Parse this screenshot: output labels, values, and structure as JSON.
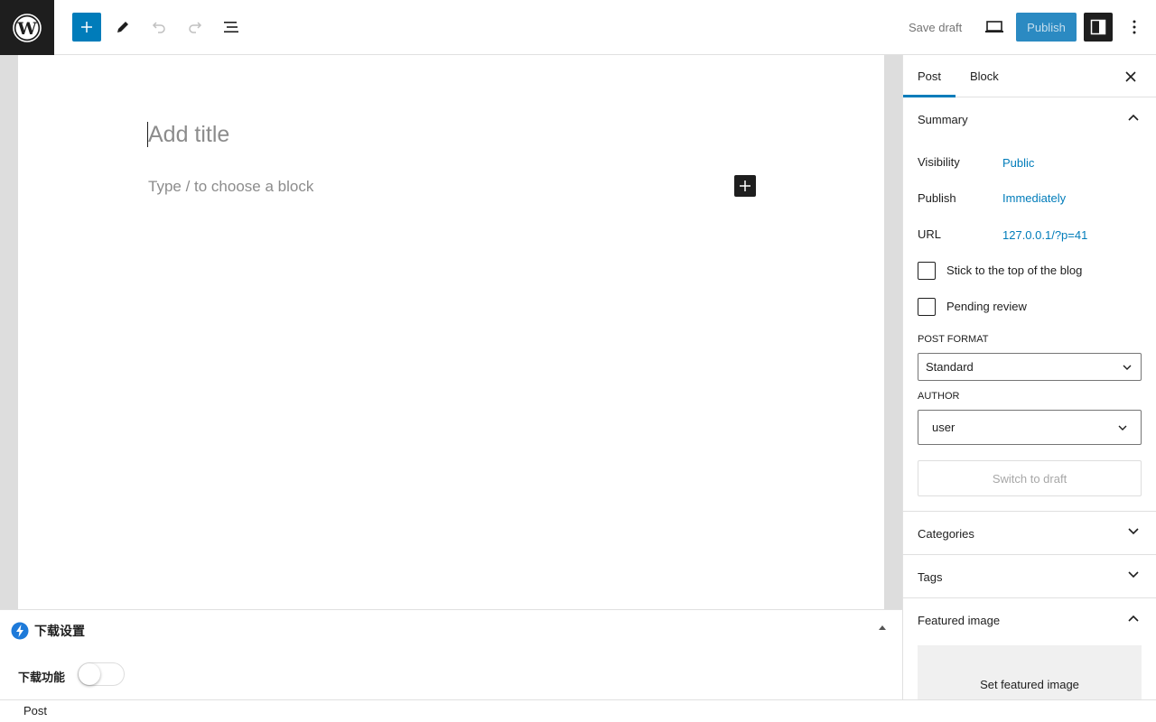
{
  "toolbar": {
    "logo_icon": "wordpress-logo",
    "add_block_icon": "plus-icon",
    "tools_icon": "pencil-icon",
    "undo_icon": "undo-icon",
    "redo_icon": "redo-icon",
    "list_view_icon": "list-view-icon",
    "save_draft_label": "Save draft",
    "preview_icon": "desktop-preview-icon",
    "publish_label": "Publish",
    "settings_icon": "sidebar-toggle-icon",
    "options_icon": "more-vertical-icon",
    "accent_color": "#007cba"
  },
  "editor": {
    "title_placeholder": "Add title",
    "block_placeholder": "Type / to choose a block"
  },
  "metabox": {
    "title": "下载设置",
    "icon": "bolt-logo-icon",
    "download_label": "下载功能",
    "download_enabled": false
  },
  "footer": {
    "breadcrumb": "Post"
  },
  "sidebar": {
    "tabs": [
      {
        "label": "Post",
        "active": true
      },
      {
        "label": "Block",
        "active": false
      }
    ],
    "summary": {
      "title": "Summary",
      "visibility_label": "Visibility",
      "visibility_value": "Public",
      "publish_label": "Publish",
      "publish_value": "Immediately",
      "url_label": "URL",
      "url_value": "127.0.0.1/?p=41",
      "sticky_label": "Stick to the top of the blog",
      "sticky_checked": false,
      "pending_label": "Pending review",
      "pending_checked": false,
      "post_format_label": "POST FORMAT",
      "post_format_value": "Standard",
      "author_label": "AUTHOR",
      "author_value": "user",
      "switch_draft_label": "Switch to draft"
    },
    "panels": {
      "categories": "Categories",
      "tags": "Tags",
      "featured_image": "Featured image",
      "set_featured_label": "Set featured image"
    }
  }
}
